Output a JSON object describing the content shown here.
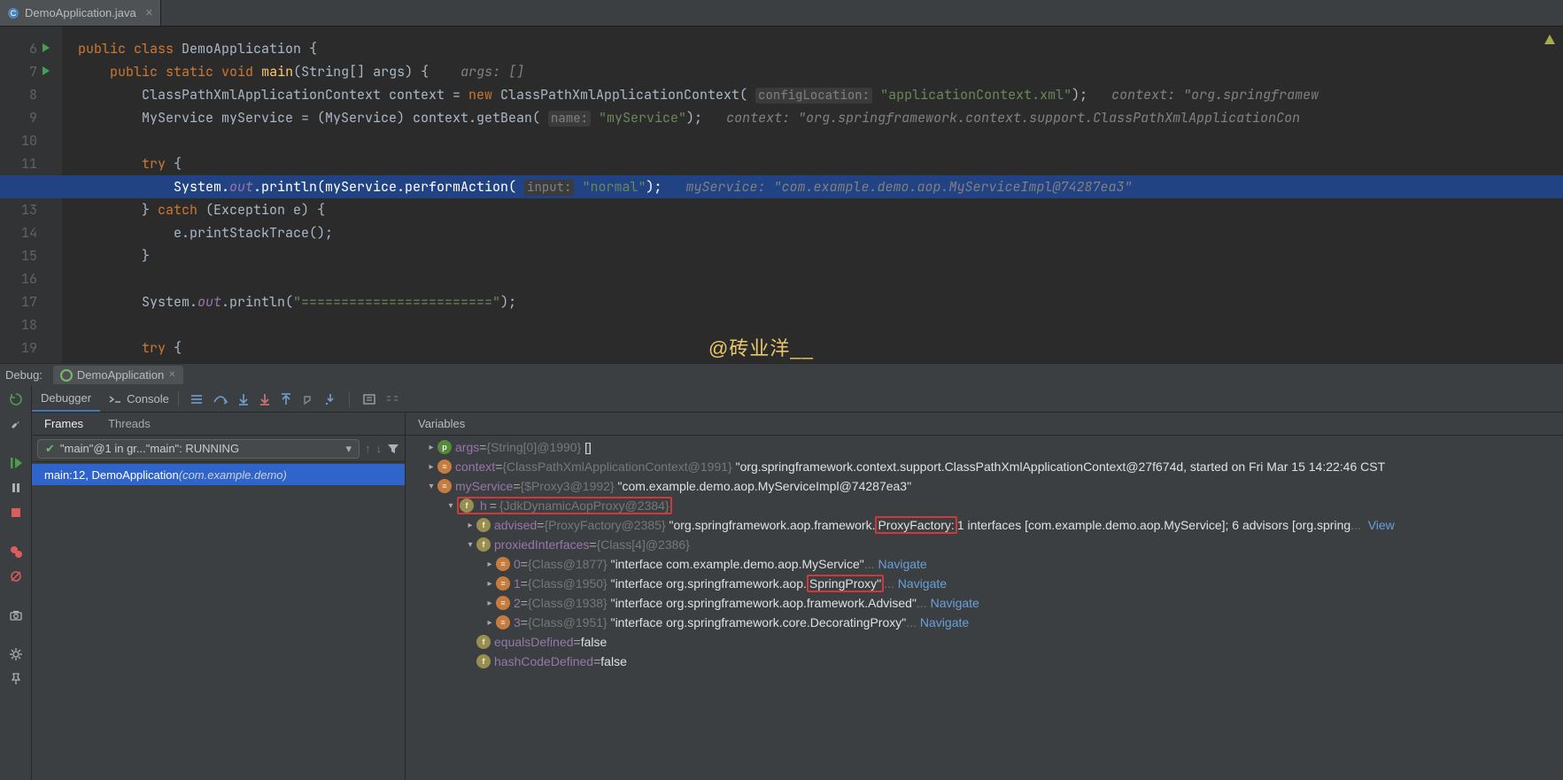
{
  "editor": {
    "tab": {
      "filename": "DemoApplication.java"
    },
    "lines_start": 6,
    "linecount": 14,
    "breakpoint_line": 12,
    "runnable_lines": [
      6,
      7
    ],
    "code_tokens": [
      [
        [
          "kw",
          "public "
        ],
        [
          "kw",
          "class "
        ],
        [
          "",
          "DemoApplication {"
        ]
      ],
      [
        [
          "",
          "    "
        ],
        [
          "kw",
          "public "
        ],
        [
          "kw",
          "static "
        ],
        [
          "kw",
          "void "
        ],
        [
          "mth",
          "main"
        ],
        [
          "",
          "(String[] args) {    "
        ],
        [
          "cmt",
          "args: []"
        ]
      ],
      [
        [
          "",
          "        ClassPathXmlApplicationContext context = "
        ],
        [
          "kw",
          "new "
        ],
        [
          "",
          "ClassPathXmlApplicationContext( "
        ],
        [
          "hint",
          "configLocation:"
        ],
        [
          "",
          " "
        ],
        [
          "str",
          "\"applicationContext.xml\""
        ],
        [
          "",
          ");   "
        ],
        [
          "cmt",
          "context: \"org.springframew"
        ]
      ],
      [
        [
          "",
          "        MyService myService = (MyService) context.getBean( "
        ],
        [
          "hint",
          "name:"
        ],
        [
          "",
          " "
        ],
        [
          "str",
          "\"myService\""
        ],
        [
          "",
          ");   "
        ],
        [
          "cmt",
          "context: \"org.springframework.context.support.ClassPathXmlApplicationCon"
        ]
      ],
      [
        [
          "",
          ""
        ]
      ],
      [
        [
          "",
          "        "
        ],
        [
          "kw",
          "try"
        ],
        [
          "",
          " {"
        ]
      ],
      [
        [
          "",
          "            System."
        ],
        [
          "pur",
          "out"
        ],
        [
          "",
          ".println(myService.performAction( "
        ],
        [
          "hint",
          "input:"
        ],
        [
          "",
          " "
        ],
        [
          "str",
          "\"normal\""
        ],
        [
          "",
          ");   "
        ],
        [
          "cmt",
          "myService: \"com.example.demo.aop.MyServiceImpl@74287ea3\""
        ]
      ],
      [
        [
          "",
          "        } "
        ],
        [
          "kw",
          "catch"
        ],
        [
          "",
          " (Exception e) {"
        ]
      ],
      [
        [
          "",
          "            e.printStackTrace();"
        ]
      ],
      [
        [
          "",
          "        }"
        ]
      ],
      [
        [
          "",
          ""
        ]
      ],
      [
        [
          "",
          "        System."
        ],
        [
          "pur",
          "out"
        ],
        [
          "",
          ".println("
        ],
        [
          "str",
          "\"========================\""
        ],
        [
          "",
          ");"
        ]
      ],
      [
        [
          "",
          ""
        ]
      ],
      [
        [
          "",
          "        "
        ],
        [
          "kw",
          "try"
        ],
        [
          "",
          " {"
        ]
      ]
    ]
  },
  "watermark": "@砖业洋__",
  "debug": {
    "label": "Debug:",
    "session_name": "DemoApplication",
    "tabs": {
      "debugger": "Debugger",
      "console": "Console"
    },
    "frames_subtabs": {
      "frames": "Frames",
      "threads": "Threads"
    },
    "thread_selector": "\"main\"@1 in gr...\"main\": RUNNING",
    "frame_item": {
      "loc": "main:12, DemoApplication ",
      "pkg": "(com.example.demo)"
    },
    "variables_label": "Variables",
    "vars": {
      "args": {
        "name": "args",
        "type": "{String[0]@1990}",
        "val": "[]"
      },
      "context": {
        "name": "context",
        "type": "{ClassPathXmlApplicationContext@1991}",
        "val": "\"org.springframework.context.support.ClassPathXmlApplicationContext@27f674d, started on Fri Mar 15 14:22:46 CST"
      },
      "myService": {
        "name": "myService",
        "type": "{$Proxy3@1992}",
        "val": "\"com.example.demo.aop.MyServiceImpl@74287ea3\""
      },
      "h": {
        "name": "h",
        "type": "{JdkDynamicAopProxy@2384}"
      },
      "advised": {
        "name": "advised",
        "type": "{ProxyFactory@2385}",
        "pre": "\"org.springframework.aop.framework.",
        "hl": "ProxyFactory:",
        "post": " 1 interfaces [com.example.demo.aop.MyService]; 6 advisors [org.spring",
        "link": "View"
      },
      "proxied": {
        "name": "proxiedInterfaces",
        "type": "{Class[4]@2386}"
      },
      "i0": {
        "name": "0",
        "type": "{Class@1877}",
        "val": "\"interface com.example.demo.aop.MyService\"",
        "link": "Navigate"
      },
      "i1": {
        "name": "1",
        "type": "{Class@1950}",
        "pre": "\"interface org.springframework.aop.",
        "hl": "SpringProxy\"",
        "link": "Navigate"
      },
      "i2": {
        "name": "2",
        "type": "{Class@1938}",
        "val": "\"interface org.springframework.aop.framework.Advised\"",
        "link": "Navigate"
      },
      "i3": {
        "name": "3",
        "type": "{Class@1951}",
        "val": "\"interface org.springframework.core.DecoratingProxy\"",
        "link": "Navigate"
      },
      "equalsDefined": {
        "name": "equalsDefined",
        "val": "false"
      },
      "hashCodeDefined": {
        "name": "hashCodeDefined",
        "val": "false"
      }
    }
  }
}
